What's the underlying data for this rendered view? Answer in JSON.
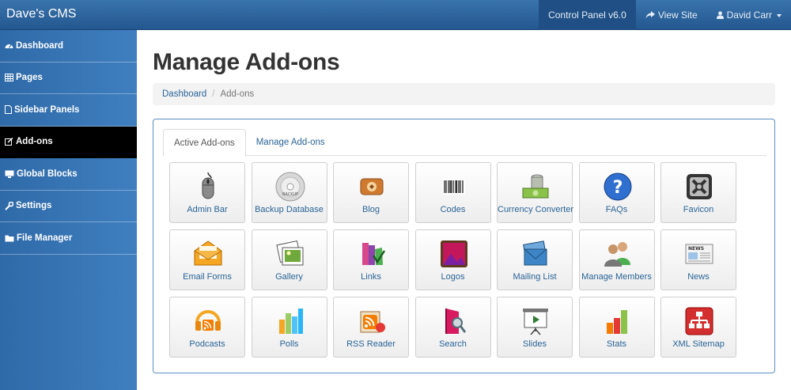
{
  "app": {
    "brand": "Dave's CMS"
  },
  "navbar": {
    "control_panel": "Control Panel v6.0",
    "view_site": "View Site",
    "user": "David Carr"
  },
  "sidebar": {
    "items": [
      {
        "label": "Dashboard",
        "icon": "dashboard-icon"
      },
      {
        "label": "Pages",
        "icon": "table-icon"
      },
      {
        "label": "Sidebar Panels",
        "icon": "file-icon"
      },
      {
        "label": "Add-ons",
        "icon": "edit-icon",
        "active": true
      },
      {
        "label": "Global Blocks",
        "icon": "monitor-icon"
      },
      {
        "label": "Settings",
        "icon": "wrench-icon"
      },
      {
        "label": "File Manager",
        "icon": "folder-icon"
      }
    ]
  },
  "page": {
    "title": "Manage Add-ons",
    "breadcrumb": {
      "link": "Dashboard",
      "separator": "/",
      "current": "Add-ons"
    }
  },
  "tabs": [
    {
      "label": "Active Add-ons",
      "active": true
    },
    {
      "label": "Manage Add-ons",
      "active": false
    }
  ],
  "addons": [
    {
      "label": "Admin Bar",
      "icon": "mouse-icon"
    },
    {
      "label": "Backup Database",
      "icon": "disc-icon"
    },
    {
      "label": "Blog",
      "icon": "blog-icon"
    },
    {
      "label": "Codes",
      "icon": "barcode-icon"
    },
    {
      "label": "Currency Converter",
      "icon": "money-icon"
    },
    {
      "label": "FAQs",
      "icon": "question-icon"
    },
    {
      "label": "Favicon",
      "icon": "favicon-icon"
    },
    {
      "label": "Email Forms",
      "icon": "envelope-icon"
    },
    {
      "label": "Gallery",
      "icon": "photos-icon"
    },
    {
      "label": "Links",
      "icon": "books-icon"
    },
    {
      "label": "Logos",
      "icon": "picture-icon"
    },
    {
      "label": "Mailing List",
      "icon": "mail-stack-icon"
    },
    {
      "label": "Manage Members",
      "icon": "users-icon"
    },
    {
      "label": "News",
      "icon": "newspaper-icon"
    },
    {
      "label": "Podcasts",
      "icon": "headphones-rss-icon"
    },
    {
      "label": "Polls",
      "icon": "bar-chart-icon"
    },
    {
      "label": "RSS Reader",
      "icon": "rss-icon"
    },
    {
      "label": "Search",
      "icon": "search-door-icon"
    },
    {
      "label": "Slides",
      "icon": "presentation-icon"
    },
    {
      "label": "Stats",
      "icon": "stats-icon"
    },
    {
      "label": "XML Sitemap",
      "icon": "sitemap-icon"
    }
  ],
  "colors": {
    "navbar": "#2c66a0",
    "sidebar": "#3a78b8",
    "link": "#2a6496",
    "panel_border": "#5b8fc0"
  }
}
